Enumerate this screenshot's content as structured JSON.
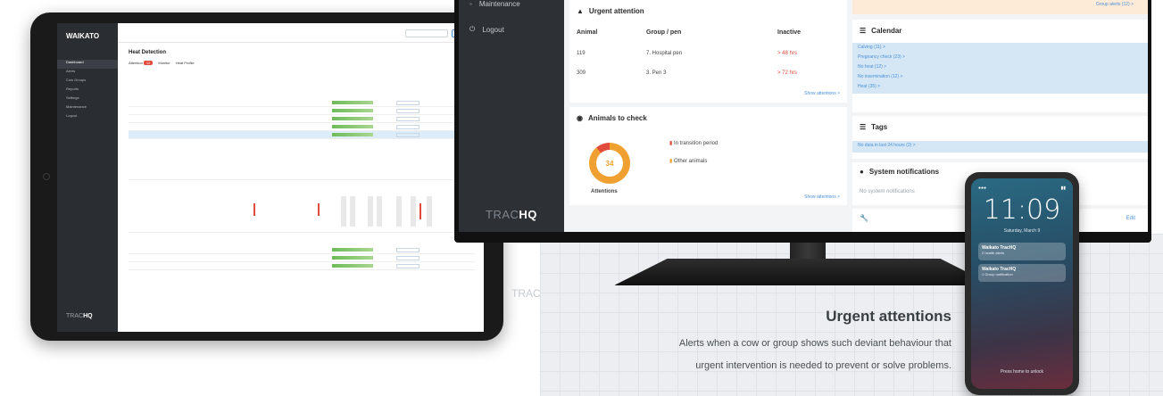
{
  "tablet": {
    "logo": "WAIKATO",
    "brand_light": "TRAC",
    "brand_bold": "HQ",
    "page_title": "Heat Detection",
    "tabs": [
      "Attention",
      "Monitor",
      "Heat Profile"
    ],
    "attention_count": "12",
    "nav": [
      "Dashboard",
      "Alerts",
      "Cow Groups",
      "Reports",
      "Settings",
      "Maintenance",
      "Logout"
    ]
  },
  "monitor": {
    "sidebar": {
      "maintenance": "Maintenance",
      "logout": "Logout",
      "brand_light": "TRAC",
      "brand_bold": "HQ"
    },
    "urgent": {
      "title": "Urgent attention",
      "columns": [
        "Animal",
        "Group / pen",
        "Inactive"
      ],
      "rows": [
        {
          "animal": "119",
          "group": "7. Hospital pen",
          "inactive": "> 48 hrs"
        },
        {
          "animal": "309",
          "group": "3. Pen 3",
          "inactive": "> 72 hrs"
        }
      ],
      "show_link": "Show attentions >"
    },
    "check": {
      "title": "Animals to check",
      "count": "34",
      "count_label": "Attentions",
      "legend": [
        "In transition period",
        "Other animals"
      ],
      "show_link": "Show attentions >"
    },
    "group_alerts": "Group alerts (12) >",
    "calendar": {
      "title": "Calendar",
      "items": [
        "Calving (11) >",
        "Pregnancy check (23) >",
        "No heat (12) >",
        "No insemination (12) >",
        "Heat (35) >"
      ]
    },
    "tags": {
      "title": "Tags",
      "items": [
        "No data in last 24 hours (2) >"
      ]
    },
    "notifications": {
      "title": "System notifications",
      "empty": "No system notifications"
    },
    "edit": "Edit"
  },
  "phone": {
    "time": "11:09",
    "date": "Saturday, March 9",
    "notifications": [
      {
        "title": "Waikato TracHQ",
        "body": "2 health alerts"
      },
      {
        "title": "Waikato TracHQ",
        "body": "1 Group notification"
      }
    ],
    "unlock": "Press home to unlock"
  },
  "caption": {
    "title": "Urgent attentions",
    "line1": "Alerts when a cow or group shows such deviant behaviour that",
    "line2": "urgent intervention is needed to prevent or solve problems."
  },
  "ghost_text": "TRAC",
  "colors": {
    "sidebar": "#2d3035",
    "alert_red": "#e24a3b",
    "warning_orange": "#f0a030",
    "calendar_blue": "#d5e7f5",
    "link_blue": "#4a90d9"
  }
}
